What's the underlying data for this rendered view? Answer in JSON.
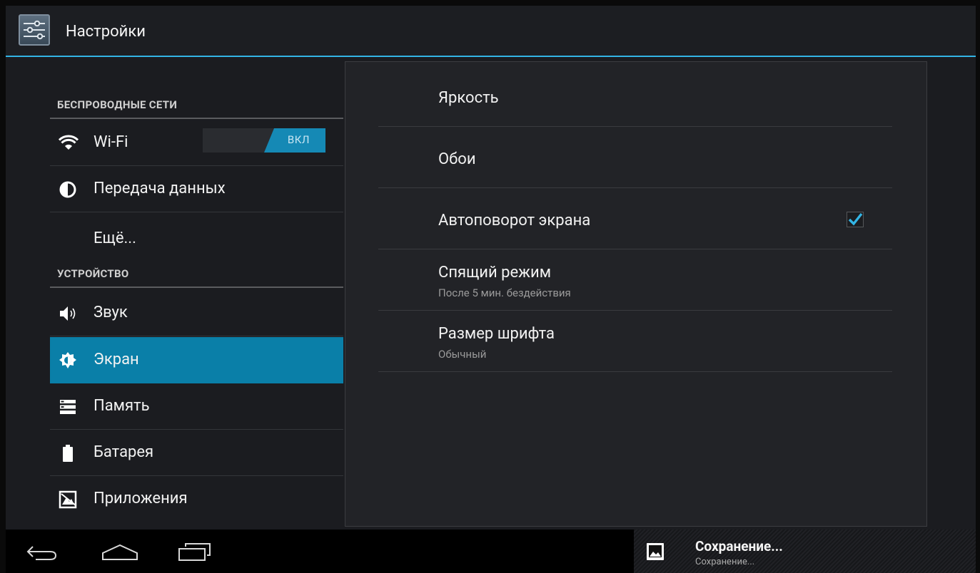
{
  "app": {
    "title": "Настройки",
    "icon": "settings-sliders-icon"
  },
  "sidebar": {
    "categories": [
      "БЕСПРОВОДНЫЕ СЕТИ",
      "УСТРОЙСТВО"
    ],
    "items": [
      {
        "label": "Wi-Fi",
        "icon": "wifi-icon",
        "toggle": "ВКЛ"
      },
      {
        "label": "Передача данных",
        "icon": "data-usage-icon"
      },
      {
        "label": "Ещё..."
      },
      {
        "label": "Звук",
        "icon": "sound-icon"
      },
      {
        "label": "Экран",
        "icon": "display-brightness-icon",
        "selected": true
      },
      {
        "label": "Память",
        "icon": "storage-icon"
      },
      {
        "label": "Батарея",
        "icon": "battery-icon"
      },
      {
        "label": "Приложения",
        "icon": "apps-icon"
      }
    ]
  },
  "display_settings": [
    {
      "title": "Яркость"
    },
    {
      "title": "Обои"
    },
    {
      "title": "Автоповорот экрана",
      "checked": true
    },
    {
      "title": "Спящий режим",
      "subtitle": "После 5 мин. бездействия"
    },
    {
      "title": "Размер шрифта",
      "subtitle": "Обычный"
    }
  ],
  "notification": {
    "title": "Сохранение...",
    "subtitle": "Сохранение...",
    "icon": "image-icon"
  },
  "navbar": {
    "buttons": [
      "back-icon",
      "home-icon",
      "recent-apps-icon"
    ]
  },
  "colors": {
    "accent": "#33b5e5",
    "selected": "#0a7fa8",
    "toggle_on": "#1589b5"
  }
}
